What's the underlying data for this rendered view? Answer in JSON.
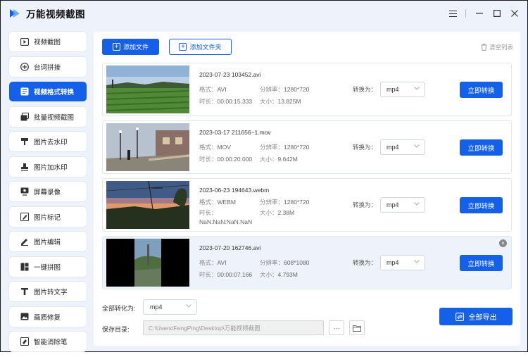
{
  "app": {
    "title": "万能视频截图"
  },
  "window_controls": [
    "menu-icon",
    "minimize-icon",
    "maximize-icon",
    "close-icon"
  ],
  "colors": {
    "accent": "#1560e8",
    "sidebar_bg": "#eef3fb"
  },
  "sidebar": {
    "items": [
      {
        "label": "视频截图",
        "icon": "video-capture-icon",
        "active": false
      },
      {
        "label": "台词拼接",
        "icon": "add-circle-icon",
        "active": false
      },
      {
        "label": "视频格式转换",
        "icon": "video-convert-icon",
        "active": true
      },
      {
        "label": "批量视频截图",
        "icon": "batch-capture-icon",
        "active": false
      },
      {
        "label": "图片去水印",
        "icon": "stamp-icon",
        "active": false
      },
      {
        "label": "图片加水印",
        "icon": "stamp-add-icon",
        "active": false
      },
      {
        "label": "屏幕录像",
        "icon": "screen-record-icon",
        "active": false
      },
      {
        "label": "图片标记",
        "icon": "mark-icon",
        "active": false
      },
      {
        "label": "图片编辑",
        "icon": "edit-icon",
        "active": false
      },
      {
        "label": "一键拼图",
        "icon": "collage-icon",
        "active": false
      },
      {
        "label": "图片转文字",
        "icon": "text-icon",
        "active": false
      },
      {
        "label": "画质修复",
        "icon": "image-icon",
        "active": false
      },
      {
        "label": "智能消除笔",
        "icon": "eraser-icon",
        "active": false
      }
    ]
  },
  "toolbar": {
    "add_file": "添加文件",
    "add_folder": "添加文件夹",
    "clear_list": "清空列表"
  },
  "files": [
    {
      "name": "2023-07-23 103452.avi",
      "format_label": "格式：",
      "format": "AVI",
      "resolution_label": "分辨率：",
      "resolution": "1280*720",
      "duration_label": "时长：",
      "duration": "00:00:15.333",
      "size_label": "大小：",
      "size": "13.825M",
      "convert_label": "转换为：",
      "target": "mp4",
      "button": "立即转换"
    },
    {
      "name": "2023-03-17 211656~1.mov",
      "format_label": "格式：",
      "format": "MOV",
      "resolution_label": "分辨率：",
      "resolution": "1280*720",
      "duration_label": "时长：",
      "duration": "00:00:20.000",
      "size_label": "大小：",
      "size": "9.642M",
      "convert_label": "转换为：",
      "target": "mp4",
      "button": "立即转换"
    },
    {
      "name": "2023-06-23 194643.webm",
      "format_label": "格式：",
      "format": "WEBM",
      "resolution_label": "分辨率：",
      "resolution": "1280*720",
      "duration_label": "时长：",
      "duration": "NaN:NaN:NaN.NaN",
      "size_label": "大小：",
      "size": "2.38M",
      "convert_label": "转换为：",
      "target": "mp4",
      "button": "立即转换"
    },
    {
      "name": "2023-07-20 162746.avi",
      "format_label": "格式：",
      "format": "AVI",
      "resolution_label": "分辨率：",
      "resolution": "608*1080",
      "duration_label": "时长：",
      "duration": "00:00:07.166",
      "size_label": "大小：",
      "size": "4.793M",
      "convert_label": "转换为：",
      "target": "mp4",
      "button": "立即转换"
    }
  ],
  "bottom": {
    "convert_all_label": "全部转化为:",
    "convert_all_value": "mp4",
    "save_dir_label": "保存目录:",
    "save_dir_value": "C:\\Users\\FengPing\\Desktop\\万能视频截图",
    "more_button": "···",
    "export_button": "全部导出"
  }
}
